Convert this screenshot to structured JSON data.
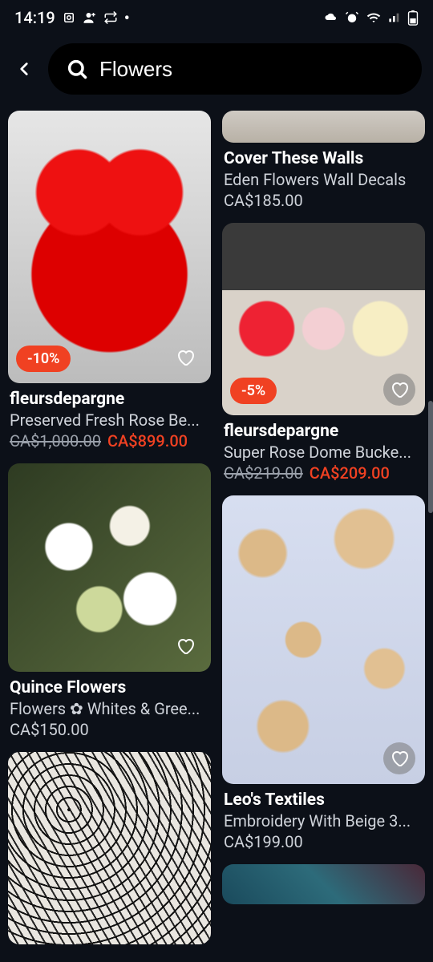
{
  "status": {
    "time": "14:19",
    "dot": "•"
  },
  "search": {
    "value": "Flowers"
  },
  "left_col": [
    {
      "id": "rosebear",
      "discount": "-10%",
      "vendor": "fleursdepargne",
      "title": "Preserved Fresh Rose Be...",
      "old_price": "CA$1,000.00",
      "new_price": "CA$899.00",
      "heart_bubble": false
    },
    {
      "id": "quince",
      "vendor": "Quince Flowers",
      "title": "Flowers ✿ Whites & Gree...",
      "price": "CA$150.00",
      "heart_bubble": false
    },
    {
      "id": "blacklace"
    }
  ],
  "right_col": [
    {
      "id": "walls",
      "vendor": "Cover These Walls",
      "title": "Eden Flowers Wall Decals",
      "price": "CA$185.00"
    },
    {
      "id": "domes",
      "discount": "-5%",
      "vendor": "fleursdepargne",
      "title": "Super Rose Dome Bucke...",
      "old_price": "CA$219.00",
      "new_price": "CA$209.00",
      "heart_bubble": true
    },
    {
      "id": "embroidery",
      "vendor": "Leo's Textiles",
      "title": "Embroidery With Beige 3...",
      "price": "CA$199.00",
      "heart_bubble": true
    },
    {
      "id": "bottom"
    }
  ]
}
